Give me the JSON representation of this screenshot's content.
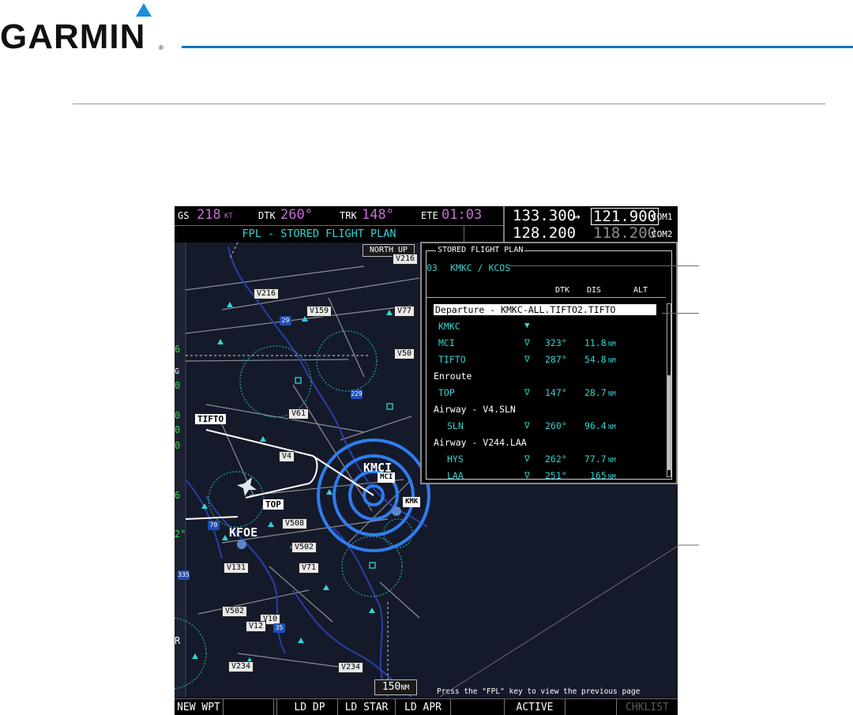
{
  "brand": {
    "name": "GARMIN",
    "reg": "®"
  },
  "colors": {
    "brand_blue": "#1673b8",
    "cyan": "#34d3d3",
    "magenta": "#c86dd6",
    "screen_bg": "#0e1420"
  },
  "navbar": {
    "gs_label": "GS",
    "gs_value": "218",
    "gs_unit": "KT",
    "dtk_label": "DTK",
    "dtk_value": "260°",
    "trk_label": "TRK",
    "trk_value": "148°",
    "ete_label": "ETE",
    "ete_value": "01:03"
  },
  "page_title": "FPL - STORED FLIGHT PLAN",
  "com": {
    "com1_active": "133.300",
    "com1_standby": "121.900",
    "com1_label": "COM1",
    "com2_active": "128.200",
    "com2_standby": "118.200",
    "com2_label": "COM2",
    "transfer_icon": "↔"
  },
  "map": {
    "orientation": "NORTH UP",
    "range_value": "150",
    "range_unit": "NM",
    "airways": [
      "V216",
      "V216",
      "V159",
      "V77",
      "V50",
      "V61",
      "V4",
      "V508",
      "V502",
      "V131",
      "V71",
      "V502",
      "V10",
      "V12",
      "V234",
      "V234"
    ],
    "waypoints": [
      "TIFTO",
      "TOP",
      "MCI",
      "KMK"
    ],
    "airports": [
      "KMCI",
      "KFOE"
    ],
    "shields": [
      "29",
      "229",
      "70",
      "335",
      "35",
      "335"
    ],
    "left_edge": [
      "6",
      "G",
      "0",
      "0",
      "0",
      "0",
      "6",
      "2°",
      "R"
    ]
  },
  "fpl": {
    "window_title": "STORED FLIGHT PLAN",
    "plan_number": "03",
    "plan_name": "KMKC / KCOS",
    "columns": {
      "dtk": "DTK",
      "dis": "DIS",
      "alt": "ALT"
    },
    "rows": [
      {
        "type": "group",
        "text": "Departure - KMKC-ALL.TIFTO2.TIFTO",
        "selected": true
      },
      {
        "type": "wpt",
        "name": "KMKC",
        "dtk": "",
        "dis": "",
        "unit": ""
      },
      {
        "type": "wpt",
        "name": "MCI",
        "dtk": "323°",
        "dis": "11.8",
        "unit": "NM"
      },
      {
        "type": "wpt",
        "name": "TIFTO",
        "dtk": "287°",
        "dis": "54.8",
        "unit": "NM"
      },
      {
        "type": "group",
        "text": "Enroute",
        "selected": false
      },
      {
        "type": "wpt",
        "name": "TOP",
        "dtk": "147°",
        "dis": "28.7",
        "unit": "NM"
      },
      {
        "type": "group",
        "text": "Airway - V4.SLN",
        "selected": false
      },
      {
        "type": "wpt",
        "name": "SLN",
        "dtk": "260°",
        "dis": "96.4",
        "unit": "NM"
      },
      {
        "type": "group",
        "text": "Airway - V244.LAA",
        "selected": false
      },
      {
        "type": "wpt",
        "name": "HYS",
        "dtk": "262°",
        "dis": "77.7",
        "unit": "NM"
      },
      {
        "type": "wpt",
        "name": "LAA",
        "dtk": "251°",
        "dis": "165",
        "unit": "NM"
      }
    ],
    "hint": "Press the \"FPL\" key to view the previous page"
  },
  "softkeys": [
    {
      "label": "NEW WPT",
      "enabled": true
    },
    {
      "label": "",
      "enabled": true
    },
    {
      "label": "",
      "enabled": true
    },
    {
      "label": "LD DP",
      "enabled": true
    },
    {
      "label": "LD STAR",
      "enabled": true
    },
    {
      "label": "LD APR",
      "enabled": true
    },
    {
      "label": "",
      "enabled": true
    },
    {
      "label": "ACTIVE",
      "enabled": true
    },
    {
      "label": "",
      "enabled": true
    },
    {
      "label": "CHKLIST",
      "enabled": false
    }
  ]
}
